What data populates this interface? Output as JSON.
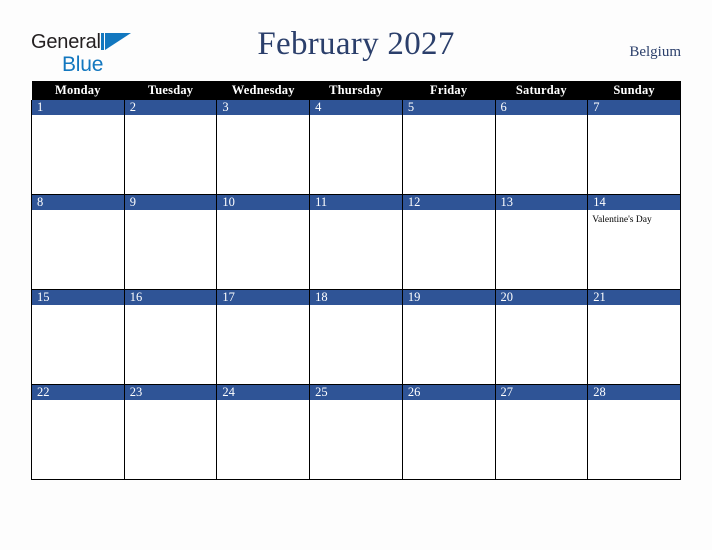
{
  "brand": {
    "word_one": "General",
    "word_two": "Blue",
    "mark_icon": "flag-triangle-icon",
    "accent_color": "#1277bf",
    "text_color": "#231f20"
  },
  "header": {
    "title": "February 2027",
    "country": "Belgium",
    "title_color": "#2b3f6b"
  },
  "calendar": {
    "month": "February",
    "year": "2027",
    "accent_color": "#2f5496",
    "header_background": "#000000",
    "weekday_headers": [
      "Monday",
      "Tuesday",
      "Wednesday",
      "Thursday",
      "Friday",
      "Saturday",
      "Sunday"
    ],
    "weeks": [
      [
        {
          "day": "1",
          "events": []
        },
        {
          "day": "2",
          "events": []
        },
        {
          "day": "3",
          "events": []
        },
        {
          "day": "4",
          "events": []
        },
        {
          "day": "5",
          "events": []
        },
        {
          "day": "6",
          "events": []
        },
        {
          "day": "7",
          "events": []
        }
      ],
      [
        {
          "day": "8",
          "events": []
        },
        {
          "day": "9",
          "events": []
        },
        {
          "day": "10",
          "events": []
        },
        {
          "day": "11",
          "events": []
        },
        {
          "day": "12",
          "events": []
        },
        {
          "day": "13",
          "events": []
        },
        {
          "day": "14",
          "events": [
            "Valentine's Day"
          ]
        }
      ],
      [
        {
          "day": "15",
          "events": []
        },
        {
          "day": "16",
          "events": []
        },
        {
          "day": "17",
          "events": []
        },
        {
          "day": "18",
          "events": []
        },
        {
          "day": "19",
          "events": []
        },
        {
          "day": "20",
          "events": []
        },
        {
          "day": "21",
          "events": []
        }
      ],
      [
        {
          "day": "22",
          "events": []
        },
        {
          "day": "23",
          "events": []
        },
        {
          "day": "24",
          "events": []
        },
        {
          "day": "25",
          "events": []
        },
        {
          "day": "26",
          "events": []
        },
        {
          "day": "27",
          "events": []
        },
        {
          "day": "28",
          "events": []
        }
      ]
    ]
  }
}
